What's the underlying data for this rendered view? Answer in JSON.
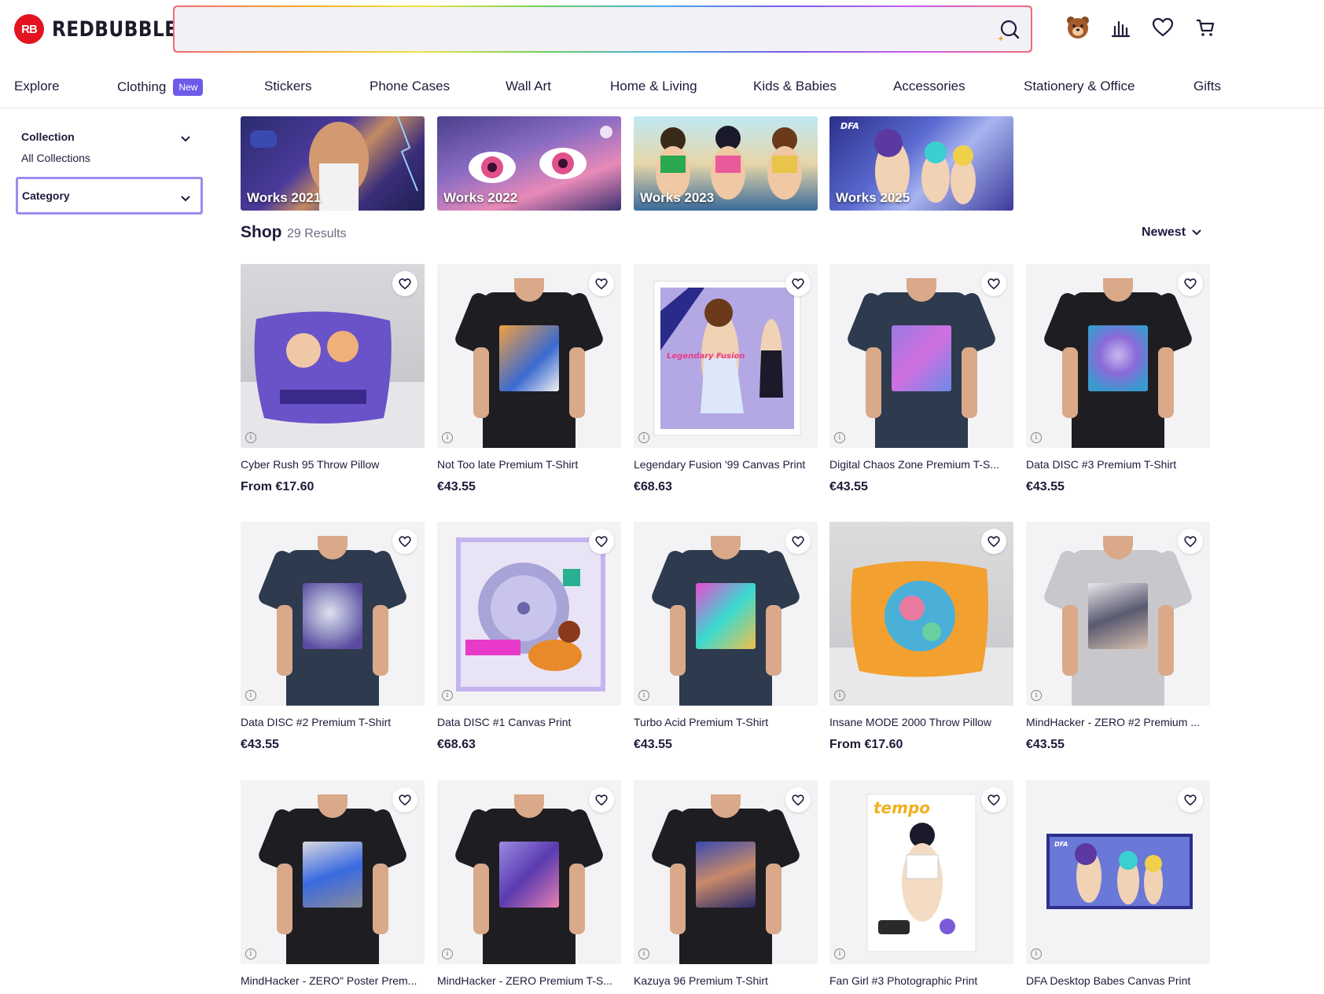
{
  "brand": {
    "logo_mark": "RB",
    "name": "REDBUBBLE",
    "color": "#e41321"
  },
  "search": {
    "placeholder": "",
    "value": "",
    "icon": "sparkle-search-icon"
  },
  "header_icons": [
    "avatar-bear",
    "stats-icon",
    "heart-icon",
    "cart-icon"
  ],
  "nav": {
    "explore": "Explore",
    "clothing": "Clothing",
    "clothing_badge": "New",
    "stickers": "Stickers",
    "phone_cases": "Phone Cases",
    "wall_art": "Wall Art",
    "home_living": "Home & Living",
    "kids_babies": "Kids & Babies",
    "accessories": "Accessories",
    "stationery": "Stationery & Office",
    "gifts": "Gifts"
  },
  "sidebar": {
    "collection_label": "Collection",
    "collection_value": "All Collections",
    "category_label": "Category"
  },
  "works": [
    {
      "label": "Works 2021"
    },
    {
      "label": "Works 2022"
    },
    {
      "label": "Works 2023"
    },
    {
      "label": "Works 2025"
    }
  ],
  "shop": {
    "title": "Shop",
    "count": "29 Results",
    "sort": "Newest"
  },
  "products": [
    {
      "title": "Cyber Rush 95 Throw Pillow",
      "price": "From €17.60"
    },
    {
      "title": "Not Too late Premium T-Shirt",
      "price": "€43.55"
    },
    {
      "title": "Legendary Fusion '99 Canvas Print",
      "price": "€68.63"
    },
    {
      "title": "Digital Chaos Zone Premium T-S...",
      "price": "€43.55"
    },
    {
      "title": "Data DISC #3 Premium T-Shirt",
      "price": "€43.55"
    },
    {
      "title": "Data DISC #2 Premium T-Shirt",
      "price": "€43.55"
    },
    {
      "title": "Data DISC #1 Canvas Print",
      "price": "€68.63"
    },
    {
      "title": "Turbo Acid Premium T-Shirt",
      "price": "€43.55"
    },
    {
      "title": "Insane MODE 2000 Throw Pillow",
      "price": "From €17.60"
    },
    {
      "title": "MindHacker - ZERO #2 Premium ...",
      "price": "€43.55"
    },
    {
      "title": "MindHacker - ZERO\" Poster Prem...",
      "price": ""
    },
    {
      "title": "MindHacker - ZERO Premium T-S...",
      "price": ""
    },
    {
      "title": "Kazuya 96 Premium T-Shirt",
      "price": ""
    },
    {
      "title": "Fan Girl #3 Photographic Print",
      "price": ""
    },
    {
      "title": "DFA Desktop Babes Canvas Print",
      "price": ""
    }
  ]
}
